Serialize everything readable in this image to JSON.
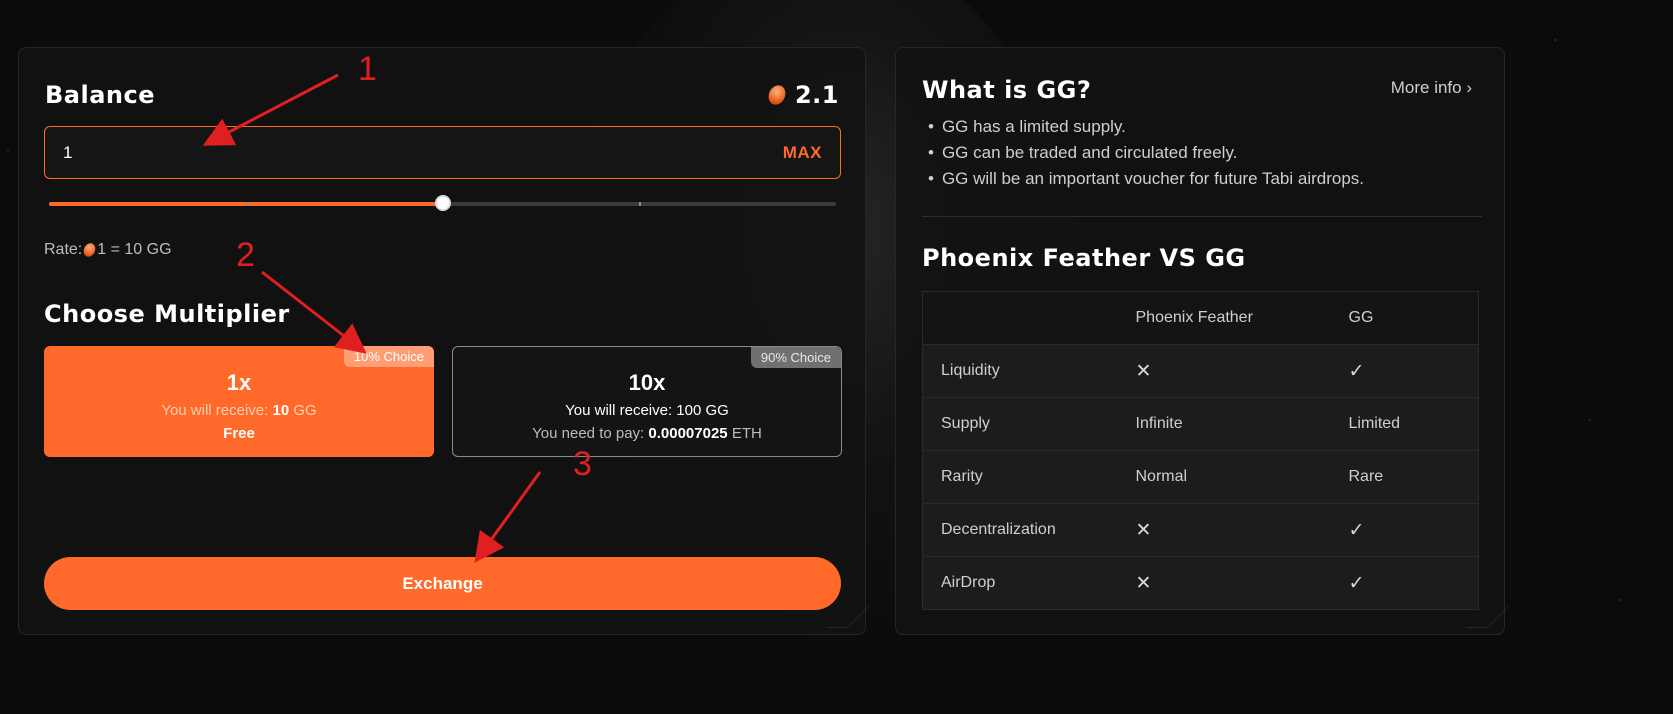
{
  "balance": {
    "title": "Balance",
    "value": "2.1",
    "input_value": "1",
    "max_label": "MAX",
    "slider_fraction": 0.5,
    "rate_prefix": "Rate:",
    "rate_text": "1 = 10 GG"
  },
  "multiplier": {
    "title": "Choose Multiplier",
    "options": [
      {
        "badge": "10% Choice",
        "label": "1x",
        "receive_prefix": "You will receive:",
        "receive_amount": "10",
        "receive_unit": "GG",
        "cost": "Free",
        "selected": true
      },
      {
        "badge": "90% Choice",
        "label": "10x",
        "receive_text": "You will receive: 100 GG",
        "pay_prefix": "You need to pay:",
        "pay_amount": "0.00007025",
        "pay_unit": "ETH",
        "selected": false
      }
    ]
  },
  "exchange_label": "Exchange",
  "info": {
    "title": "What is GG?",
    "more_info": "More info ›",
    "bullets": [
      "GG has a limited supply.",
      "GG can be traded and circulated freely.",
      "GG will be an important voucher for future Tabi airdrops."
    ]
  },
  "comparison": {
    "title": "Phoenix Feather VS GG",
    "headers": [
      "",
      "Phoenix Feather",
      "GG"
    ],
    "rows": [
      [
        "Liquidity",
        "✕",
        "✓"
      ],
      [
        "Supply",
        "Infinite",
        "Limited"
      ],
      [
        "Rarity",
        "Normal",
        "Rare"
      ],
      [
        "Decentralization",
        "✕",
        "✓"
      ],
      [
        "AirDrop",
        "✕",
        "✓"
      ]
    ]
  },
  "annotations": [
    "1",
    "2",
    "3"
  ],
  "colors": {
    "accent": "#ff6a2a",
    "annotation": "#e02020",
    "background": "#0b0b0b"
  }
}
